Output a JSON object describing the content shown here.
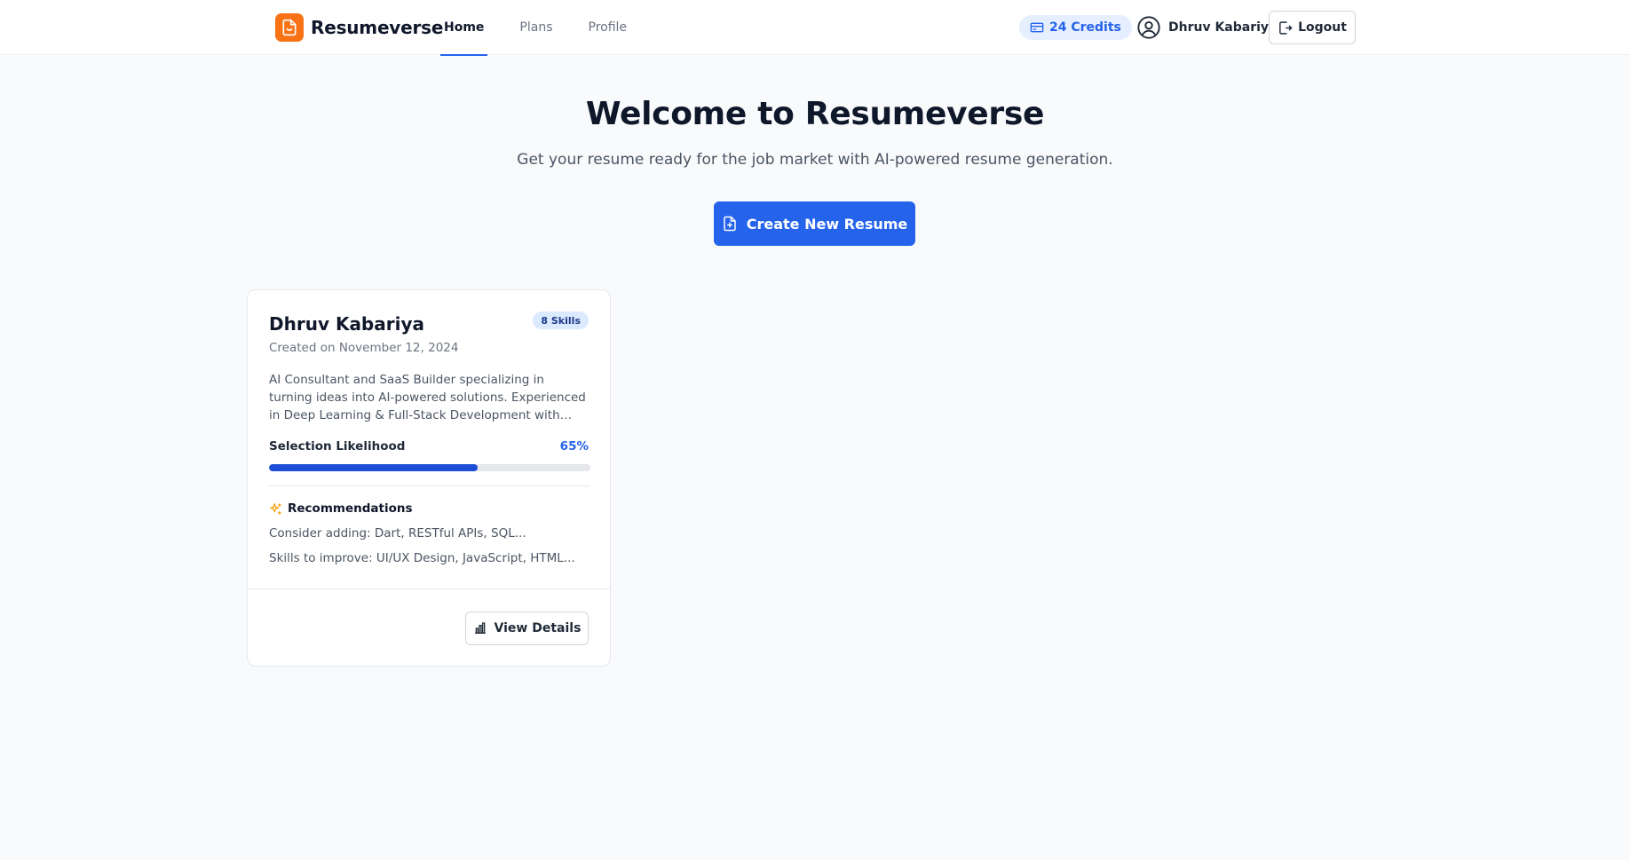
{
  "header": {
    "brand": "Resumeverse",
    "tabs": [
      {
        "label": "Home",
        "active": true
      },
      {
        "label": "Plans",
        "active": false
      },
      {
        "label": "Profile",
        "active": false
      }
    ],
    "credits": "24 Credits",
    "user_name": "Dhruv Kabariya",
    "logout_label": "Logout"
  },
  "hero": {
    "title": "Welcome to Resumeverse",
    "subtitle": "Get your resume ready for the job market with AI-powered resume generation.",
    "create_label": "Create New Resume"
  },
  "resume_card": {
    "name": "Dhruv Kabariya",
    "skills_badge": "8 Skills",
    "created": "Created on November 12, 2024",
    "description": "AI Consultant and SaaS Builder specializing in turning ideas into AI-powered solutions. Experienced in Deep Learning & Full-Stack Development with expertise in G…",
    "likelihood_label": "Selection Likelihood",
    "likelihood_value": "65%",
    "likelihood_fraction": 0.65,
    "recommendations_title": "Recommendations",
    "recommendation_add": "Consider adding: Dart, RESTful APIs, SQL...",
    "recommendation_improve": "Skills to improve: UI/UX Design, JavaScript, HTML...",
    "view_label": "View Details"
  },
  "colors": {
    "accent": "#2563eb",
    "brand": "#f97316",
    "background": "#f8fafc"
  },
  "icons": {
    "logo": "document-smile-icon",
    "credits": "credit-card-icon",
    "user": "user-circle-icon",
    "logout": "logout-icon",
    "create": "file-plus-icon",
    "recommendations": "sparkles-icon",
    "view": "bar-chart-icon"
  }
}
